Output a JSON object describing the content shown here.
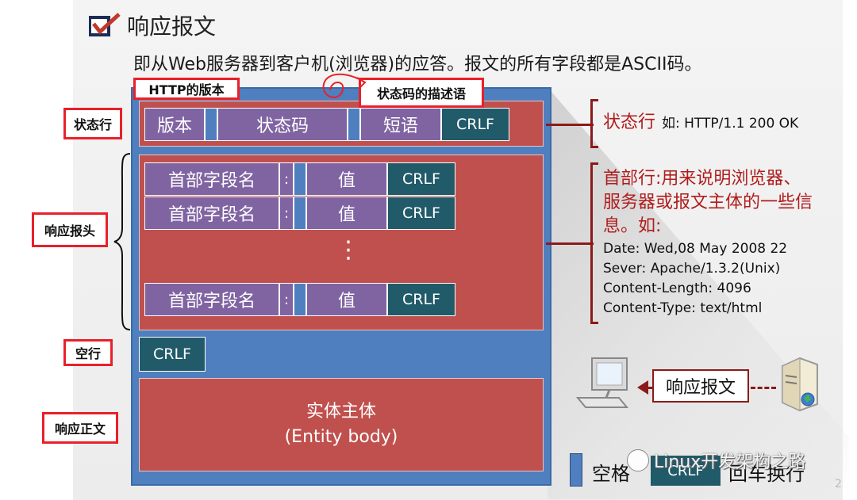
{
  "title": "响应报文",
  "subtitle": "即从Web服务器到客户机(浏览器)的应答。报文的所有字段都是ASCII码。",
  "labels": {
    "http_version": "HTTP的版本",
    "status_desc": "状态码的描述语",
    "status_line": "状态行",
    "response_header": "响应报头",
    "blank_line": "空行",
    "response_body": "响应正文"
  },
  "status_row": {
    "version": "版本",
    "status_code": "状态码",
    "phrase": "短语",
    "crlf": "CRLF"
  },
  "header_rows": [
    {
      "name": "首部字段名",
      "colon": ":",
      "value": "值",
      "crlf": "CRLF"
    },
    {
      "name": "首部字段名",
      "colon": ":",
      "value": "值",
      "crlf": "CRLF"
    },
    {
      "name": "首部字段名",
      "colon": ":",
      "value": "值",
      "crlf": "CRLF"
    }
  ],
  "ellipsis": "⋮",
  "blank_crlf": "CRLF",
  "entity": {
    "line1": "实体主体",
    "line2": "(Entity body)"
  },
  "status_anno": {
    "head": "状态行",
    "example": "如: HTTP/1.1 200 OK"
  },
  "header_anno": {
    "lines": [
      "首部行:用来说明浏览器、",
      "服务器或报文主体的一些信",
      "息。如:"
    ],
    "examples": [
      "Date:  Wed,08  May 2008 22",
      "Sever:  Apache/1.3.2(Unix)",
      "Content-Length:  4096",
      "Content-Type:  text/html"
    ]
  },
  "net": {
    "label": "响应报文"
  },
  "legend": {
    "space": "空格",
    "crlf": "CRLF",
    "crlf_desc": "回车换行"
  },
  "watermark": "Linux开发架构之路",
  "page_number": "2",
  "colors": {
    "red": "#c0504d",
    "blue": "#4f7fbf",
    "purple": "#8064a2",
    "teal": "#215a68",
    "annotation": "#b01c1c"
  }
}
